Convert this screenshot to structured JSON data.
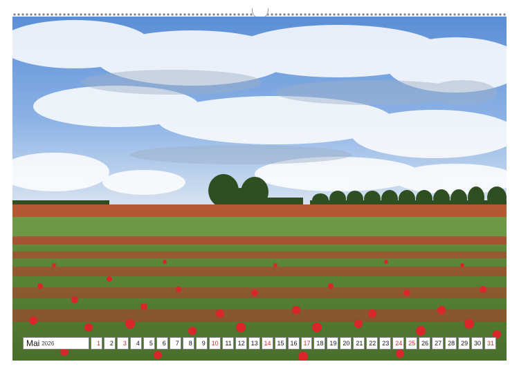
{
  "calendar": {
    "month": "Mai",
    "year": "2026",
    "days": [
      {
        "n": "1",
        "hol": true
      },
      {
        "n": "2",
        "hol": false
      },
      {
        "n": "3",
        "hol": true
      },
      {
        "n": "4",
        "hol": false
      },
      {
        "n": "5",
        "hol": false
      },
      {
        "n": "6",
        "hol": false
      },
      {
        "n": "7",
        "hol": false
      },
      {
        "n": "8",
        "hol": false
      },
      {
        "n": "9",
        "hol": false
      },
      {
        "n": "10",
        "hol": true
      },
      {
        "n": "11",
        "hol": false
      },
      {
        "n": "12",
        "hol": false
      },
      {
        "n": "13",
        "hol": false
      },
      {
        "n": "14",
        "hol": true
      },
      {
        "n": "15",
        "hol": false
      },
      {
        "n": "16",
        "hol": false
      },
      {
        "n": "17",
        "hol": true
      },
      {
        "n": "18",
        "hol": false
      },
      {
        "n": "19",
        "hol": false
      },
      {
        "n": "20",
        "hol": false
      },
      {
        "n": "21",
        "hol": false
      },
      {
        "n": "22",
        "hol": false
      },
      {
        "n": "23",
        "hol": false
      },
      {
        "n": "24",
        "hol": true
      },
      {
        "n": "25",
        "hol": true
      },
      {
        "n": "26",
        "hol": false
      },
      {
        "n": "27",
        "hol": false
      },
      {
        "n": "28",
        "hol": false
      },
      {
        "n": "29",
        "hol": false
      },
      {
        "n": "30",
        "hol": false
      },
      {
        "n": "31",
        "hol": true
      }
    ]
  },
  "colors": {
    "poppy": "#d8262b",
    "grass": "#5f8a3a",
    "sky": "#6f9fdc"
  }
}
